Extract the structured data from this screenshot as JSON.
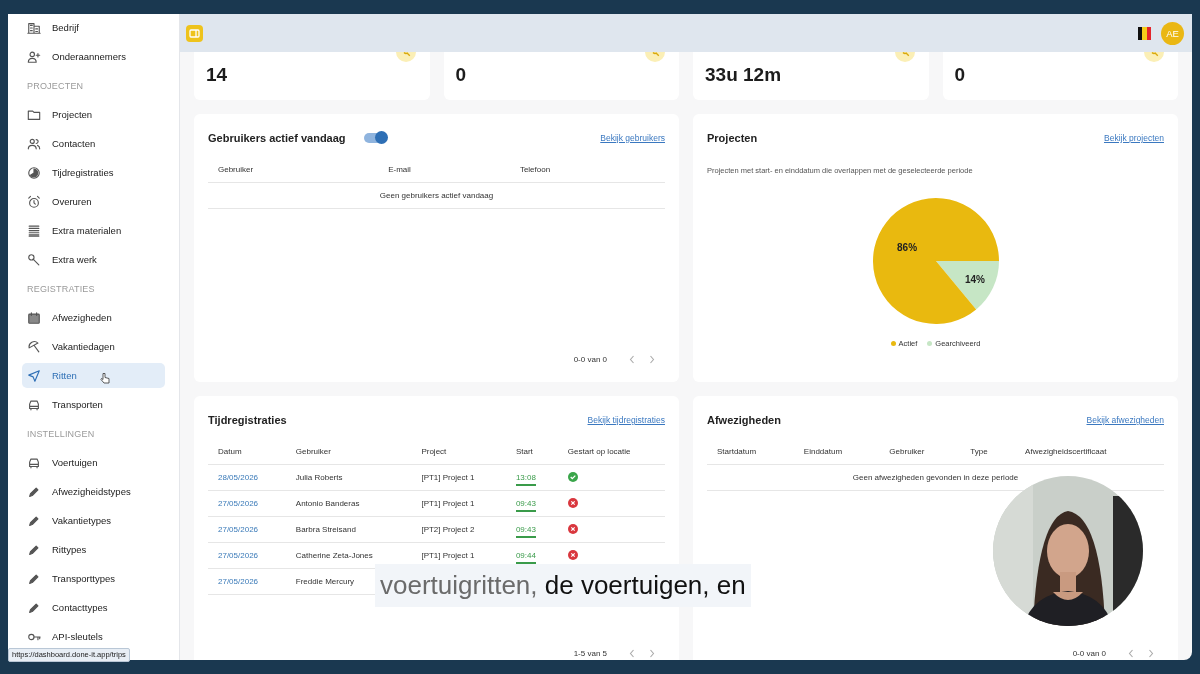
{
  "sidebar": {
    "items": [
      {
        "kind": "item",
        "label": "Bedrijf",
        "selected": false
      },
      {
        "kind": "item",
        "label": "Onderaannemers",
        "selected": false
      },
      {
        "kind": "section",
        "label": "PROJECTEN"
      },
      {
        "kind": "item",
        "label": "Projecten",
        "selected": false
      },
      {
        "kind": "item",
        "label": "Contacten",
        "selected": false
      },
      {
        "kind": "item",
        "label": "Tijdregistraties",
        "selected": false
      },
      {
        "kind": "item",
        "label": "Overuren",
        "selected": false
      },
      {
        "kind": "item",
        "label": "Extra materialen",
        "selected": false
      },
      {
        "kind": "item",
        "label": "Extra werk",
        "selected": false
      },
      {
        "kind": "section",
        "label": "REGISTRATIES"
      },
      {
        "kind": "item",
        "label": "Afwezigheden",
        "selected": false
      },
      {
        "kind": "item",
        "label": "Vakantiedagen",
        "selected": false
      },
      {
        "kind": "item",
        "label": "Ritten",
        "selected": true
      },
      {
        "kind": "item",
        "label": "Transporten",
        "selected": false
      },
      {
        "kind": "section",
        "label": "INSTELLINGEN"
      },
      {
        "kind": "item",
        "label": "Voertuigen",
        "selected": false
      },
      {
        "kind": "item",
        "label": "Afwezigheidstypes",
        "selected": false
      },
      {
        "kind": "item",
        "label": "Vakantietypes",
        "selected": false
      },
      {
        "kind": "item",
        "label": "Rittypes",
        "selected": false
      },
      {
        "kind": "item",
        "label": "Transporttypes",
        "selected": false
      },
      {
        "kind": "item",
        "label": "Contacttypes",
        "selected": false
      },
      {
        "kind": "item",
        "label": "API-sleutels",
        "selected": false
      }
    ]
  },
  "header": {
    "avatar": "AE"
  },
  "stats": [
    {
      "value": "14"
    },
    {
      "value": "0"
    },
    {
      "value": "33u 12m"
    },
    {
      "value": "0"
    }
  ],
  "active_users": {
    "title": "Gebruikers actief vandaag",
    "toggle_on": true,
    "link": "Bekijk gebruikers",
    "columns": [
      "Gebruiker",
      "E-mail",
      "Telefoon"
    ],
    "empty": "Geen gebruikers actief vandaag",
    "pagination": "0-0 van 0"
  },
  "projects": {
    "title": "Projecten",
    "link": "Bekijk projecten",
    "description": "Projecten met start- en einddatum die overlappen met de geselecteerde periode",
    "chart_data": {
      "type": "pie",
      "categories": [
        "Actief",
        "Gearchiveerd"
      ],
      "values": [
        86,
        14
      ],
      "colors": [
        "#e9b90f",
        "#c6e6c5"
      ],
      "value_labels": [
        "86%",
        "14%"
      ]
    }
  },
  "time_registrations": {
    "title": "Tijdregistraties",
    "link": "Bekijk tijdregistraties",
    "columns": [
      "Datum",
      "Gebruiker",
      "Project",
      "Start",
      "Gestart op locatie"
    ],
    "rows": [
      {
        "date": "28/05/2026",
        "user": "Julia Roberts",
        "project": "[PT1] Project 1",
        "start": "13:08",
        "on_location": true
      },
      {
        "date": "27/05/2026",
        "user": "Antonio Banderas",
        "project": "[PT1] Project 1",
        "start": "09:43",
        "on_location": false
      },
      {
        "date": "27/05/2026",
        "user": "Barbra Streisand",
        "project": "[PT2] Project 2",
        "start": "09:43",
        "on_location": false
      },
      {
        "date": "27/05/2026",
        "user": "Catherine Zeta-Jones",
        "project": "[PT1] Project 1",
        "start": "09:44",
        "on_location": false
      },
      {
        "date": "27/05/2026",
        "user": "Freddie Mercury"
      }
    ],
    "pagination": "1-5 van 5"
  },
  "absences": {
    "title": "Afwezigheden",
    "link": "Bekijk afwezigheden",
    "columns": [
      "Startdatum",
      "Einddatum",
      "Gebruiker",
      "Type",
      "Afwezigheidscertificaat"
    ],
    "empty": "Geen afwezigheden gevonden in deze periode",
    "pagination": "0-0 van 0"
  },
  "subtitle": {
    "spoken": "voertuigritten,",
    "upcoming": "de voertuigen, en"
  },
  "status_url": "https://dashboard.done-it.app/trips"
}
